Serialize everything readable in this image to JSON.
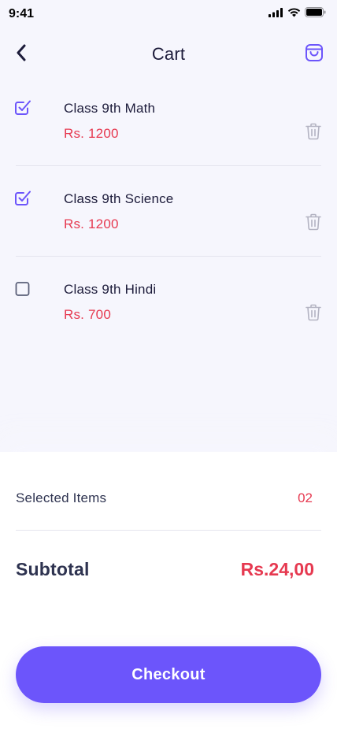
{
  "status": {
    "time": "9:41"
  },
  "header": {
    "title": "Cart"
  },
  "colors": {
    "accent": "#6c55fb",
    "price": "#e63950",
    "text": "#1c1b3a",
    "icon_muted": "#b3b3c2"
  },
  "cart": {
    "items": [
      {
        "name": "Class 9th Math",
        "price": "Rs. 1200",
        "checked": true
      },
      {
        "name": "Class 9th Science",
        "price": "Rs. 1200",
        "checked": true
      },
      {
        "name": "Class 9th Hindi",
        "price": "Rs. 700",
        "checked": false
      }
    ]
  },
  "summary": {
    "selected_label": "Selected Items",
    "selected_value": "02",
    "subtotal_label": "Subtotal",
    "subtotal_value": "Rs.24,00",
    "checkout_label": "Checkout"
  },
  "icons": {
    "back": "chevron-left-icon",
    "bag": "shopping-bag-icon",
    "checkbox_checked": "checkbox-checked-icon",
    "checkbox_empty": "checkbox-empty-icon",
    "trash": "trash-icon"
  }
}
